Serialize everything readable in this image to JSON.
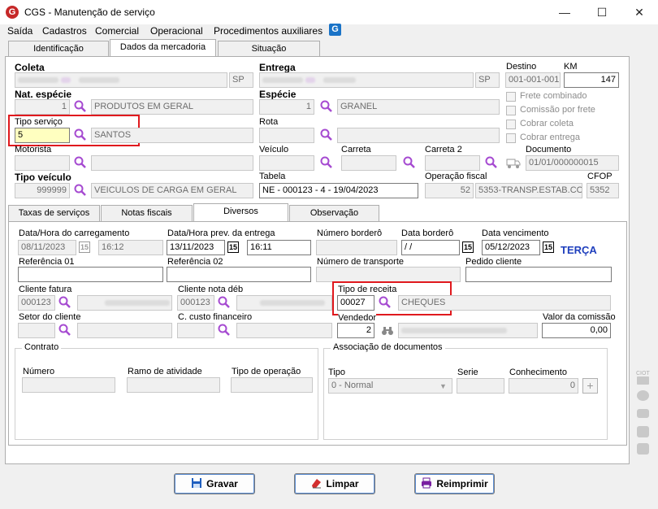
{
  "window": {
    "title": "CGS - Manutenção de serviço",
    "minimize": "—",
    "maximize": "☐",
    "close": "✕"
  },
  "menu": [
    "Saída",
    "Cadastros",
    "Comercial",
    "Operacional",
    "Procedimentos auxiliares"
  ],
  "main_tabs": [
    "Identificação",
    "Dados da mercadoria",
    "Situação"
  ],
  "coleta": {
    "label": "Coleta",
    "uf": "SP"
  },
  "entrega": {
    "label": "Entrega",
    "uf": "SP"
  },
  "destino": {
    "label": "Destino",
    "value": "001-001-001"
  },
  "km": {
    "label": "KM",
    "value": "147"
  },
  "nat_especie": {
    "label": "Nat. espécie",
    "code": "1",
    "desc": "PRODUTOS EM GERAL"
  },
  "especie": {
    "label": "Espécie",
    "code": "1",
    "desc": "GRANEL"
  },
  "checks": [
    "Frete combinado",
    "Comissão por frete",
    "Cobrar coleta",
    "Cobrar entrega"
  ],
  "tipo_servico": {
    "label": "Tipo serviço",
    "code": "5",
    "desc": "SANTOS"
  },
  "rota": {
    "label": "Rota"
  },
  "motorista": {
    "label": "Motorista"
  },
  "veiculo": {
    "label": "Veículo"
  },
  "carreta": {
    "label": "Carreta"
  },
  "carreta2": {
    "label": "Carreta 2"
  },
  "documento": {
    "label": "Documento",
    "value": "01/01/000000015"
  },
  "tipo_veiculo": {
    "label": "Tipo veículo",
    "code": "999999",
    "desc": "VEICULOS DE CARGA EM GERAL"
  },
  "tabela": {
    "label": "Tabela",
    "value": "NE - 000123 - 4 - 19/04/2023"
  },
  "operacao_fiscal": {
    "label": "Operação fiscal",
    "code": "52",
    "desc": "5353-TRANSP.ESTAB.CO"
  },
  "cfop": {
    "label": "CFOP",
    "value": "5352"
  },
  "sub_tabs": [
    "Taxas de serviços",
    "Notas fiscais",
    "Diversos",
    "Observação"
  ],
  "diversos": {
    "data_carregamento": {
      "label": "Data/Hora do carregamento",
      "date": "08/11/2023",
      "time": "16:12"
    },
    "data_prev_entrega": {
      "label": "Data/Hora prev. da entrega",
      "date": "13/11/2023",
      "time": "16:11"
    },
    "numero_bordero": {
      "label": "Número borderô"
    },
    "data_bordero": {
      "label": "Data borderô",
      "date": " / /"
    },
    "data_vencimento": {
      "label": "Data vencimento",
      "date": "05/12/2023",
      "weekday": "TERÇA"
    },
    "cal_icon": "15",
    "referencia01": {
      "label": "Referência 01"
    },
    "referencia02": {
      "label": "Referência 02"
    },
    "numero_transporte": {
      "label": "Número de transporte"
    },
    "pedido_cliente": {
      "label": "Pedido cliente"
    },
    "cliente_fatura": {
      "label": "Cliente fatura",
      "code": "000123"
    },
    "cliente_nota_deb": {
      "label": "Cliente nota déb",
      "code": "000123"
    },
    "tipo_receita": {
      "label": "Tipo de receita",
      "code": "00027",
      "desc": "CHEQUES"
    },
    "setor_cliente": {
      "label": "Setor do cliente"
    },
    "custo_financeiro": {
      "label": "C. custo financeiro"
    },
    "vendedor": {
      "label": "Vendedor",
      "code": "2"
    },
    "valor_comissao": {
      "label": "Valor da comissão",
      "value": "0,00"
    },
    "contrato": {
      "title": "Contrato",
      "numero": "Número",
      "ramo": "Ramo de atividade",
      "tipo_op": "Tipo de operação"
    },
    "assoc": {
      "title": "Associação de documentos",
      "tipo": "Tipo",
      "tipo_value": "0 - Normal",
      "serie": "Serie",
      "conhecimento": "Conhecimento",
      "conhecimento_value": "0"
    }
  },
  "buttons": {
    "gravar": "Gravar",
    "limpar": "Limpar",
    "reimprimir": "Reimprimir"
  },
  "side_icons": {
    "top_label": "CIOT"
  },
  "colors": {
    "accent_red": "#e0191e",
    "weekday_blue": "#1f3fbd",
    "app_red": "#c62828"
  }
}
